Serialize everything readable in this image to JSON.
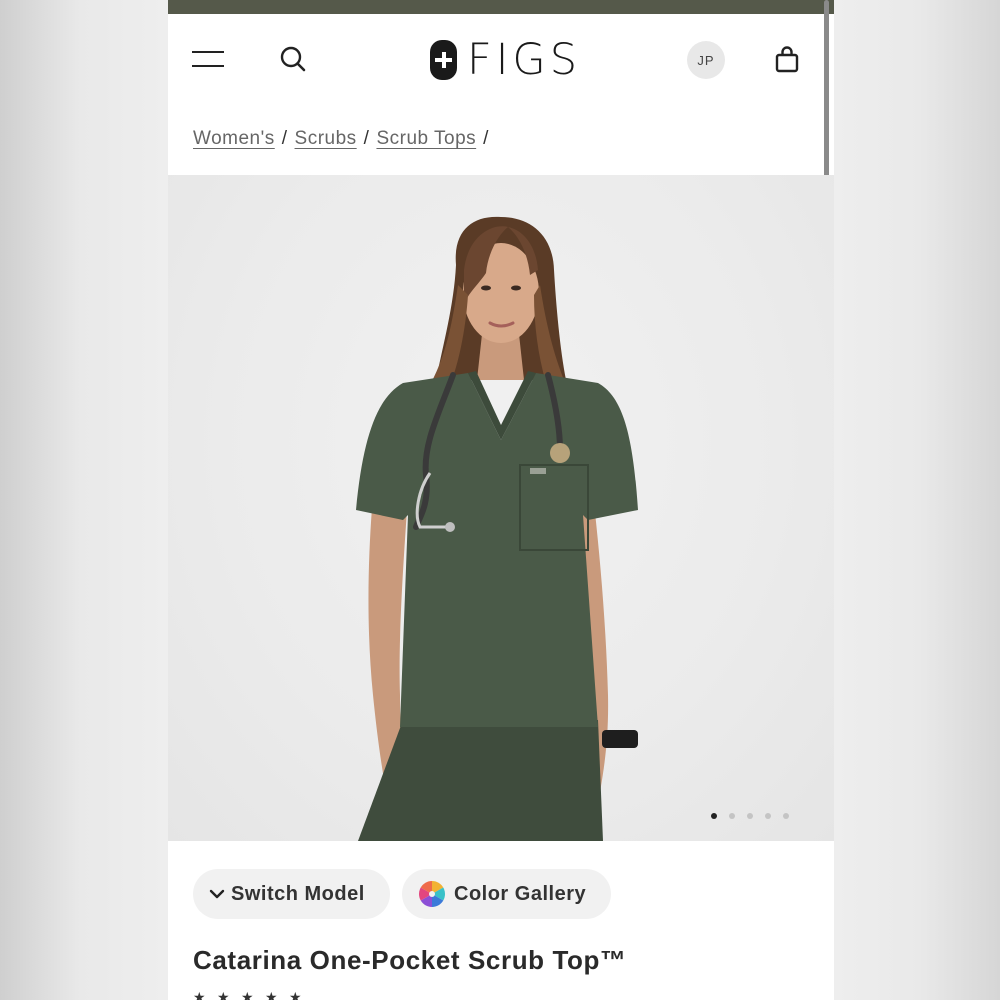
{
  "header": {
    "logo_text": "FIGS",
    "avatar_initials": "JP"
  },
  "breadcrumb": [
    "Women's",
    "Scrubs",
    "Scrub Tops"
  ],
  "breadcrumb_separator": "/",
  "gallery": {
    "total_images": 5,
    "active_index": 0,
    "scrub_color": "#4a5a48"
  },
  "actions": {
    "switch_model_label": "Switch Model",
    "color_gallery_label": "Color Gallery"
  },
  "product": {
    "title": "Catarina One-Pocket Scrub Top™",
    "rating_stars": 5
  },
  "colors": {
    "top_bar": "#55594a",
    "text_primary": "#2a2a2a",
    "pill_background": "#f1f1f1"
  }
}
